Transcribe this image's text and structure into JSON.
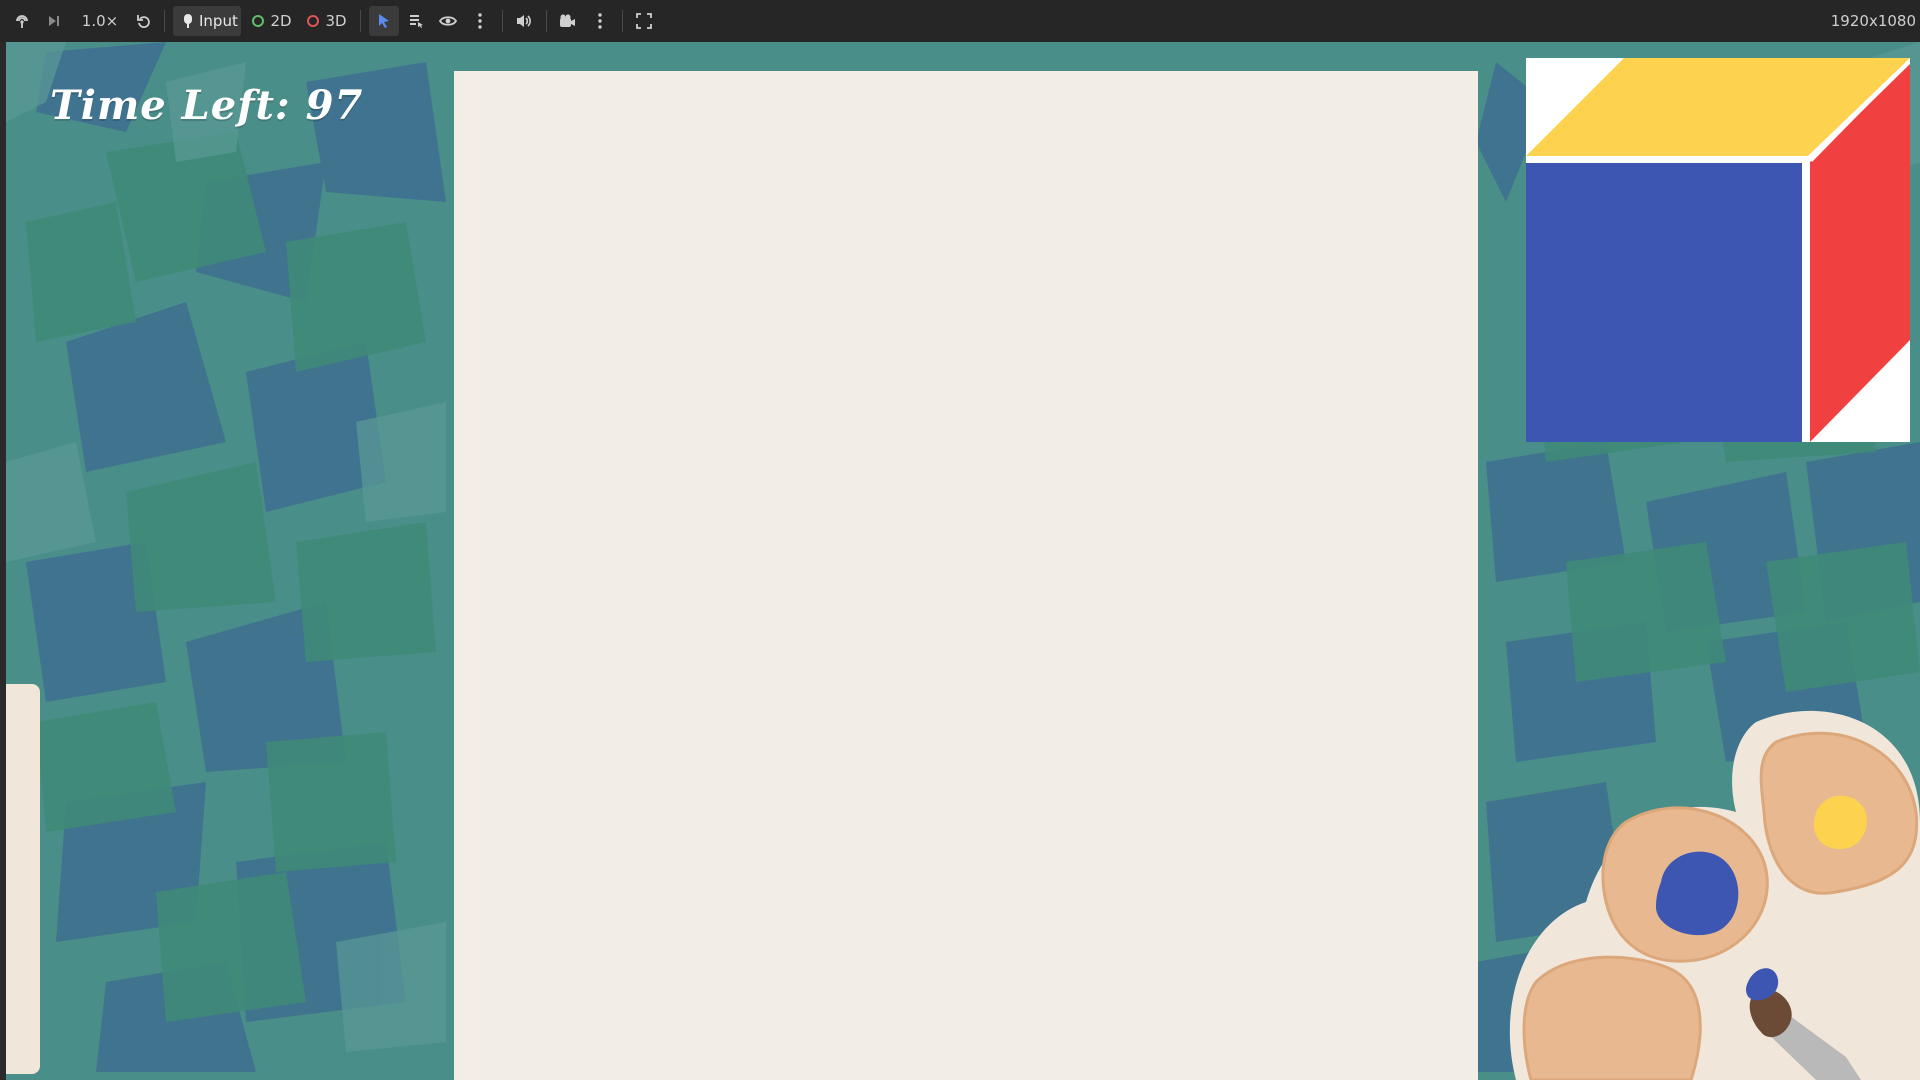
{
  "toolbar": {
    "speed_label": "1.0×",
    "input_label": "Input",
    "mode_2d_label": "2D",
    "mode_3d_label": "3D",
    "resolution_label": "1920x1080",
    "icons": [
      "remote-debug-icon",
      "step-forward-icon",
      "reset-icon",
      "input-icon",
      "select-pointer-icon",
      "layers-icon",
      "eye-icon",
      "more-vertical-icon",
      "speaker-icon",
      "camera-icon",
      "more-vertical-icon",
      "fullscreen-icon"
    ],
    "colors": {
      "bg": "#262626",
      "active": "#3b3b3b",
      "accent_2d": "#5fbf6a",
      "accent_3d": "#e05555",
      "select": "#5b8bf0"
    }
  },
  "hud": {
    "timer_text": "Time Left: 97"
  },
  "target_image": {
    "description_colors": {
      "top": "#fdd24e",
      "front": "#3d56b2",
      "side": "#f04040",
      "background": "#ffffff"
    }
  },
  "palette": {
    "wells": [
      {
        "paint": "blue",
        "color": "#3d56b2"
      },
      {
        "paint": "yellow",
        "color": "#fdd24e"
      },
      {
        "paint": "none",
        "color": null
      }
    ],
    "brush_color": "#3d56b2"
  },
  "theme": {
    "canvas": "#f2eee6",
    "background_teal": "#4b8f8a",
    "panel_cream": "#f1e6da"
  }
}
